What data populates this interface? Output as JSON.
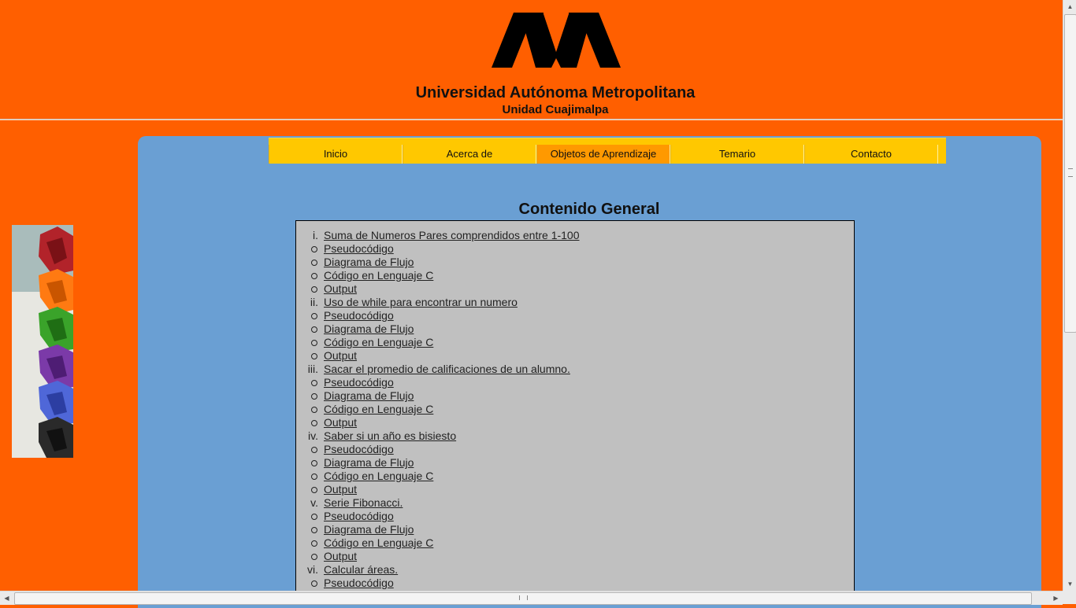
{
  "header": {
    "university": "Universidad Autónoma Metropolitana",
    "campus": "Unidad Cuajimalpa"
  },
  "nav": [
    {
      "label": "Inicio",
      "active": false
    },
    {
      "label": "Acerca de",
      "active": false
    },
    {
      "label": "Objetos de Aprendizaje",
      "active": true
    },
    {
      "label": "Temario",
      "active": false
    },
    {
      "label": "Contacto",
      "active": false
    }
  ],
  "main": {
    "title": "Contenido General",
    "topics": [
      {
        "marker": "i.",
        "title": "Suma de Numeros Pares comprendidos entre 1-100",
        "subs": [
          "Pseudocódigo",
          "Diagrama de Flujo",
          "Código en Lenguaje C",
          "Output"
        ]
      },
      {
        "marker": "ii.",
        "title": "Uso de while para encontrar un numero",
        "subs": [
          "Pseudocódigo",
          "Diagrama de Flujo",
          "Código en Lenguaje C",
          "Output"
        ]
      },
      {
        "marker": "iii.",
        "title": "Sacar el promedio de calificaciones de un alumno.",
        "subs": [
          "Pseudocódigo",
          "Diagrama de Flujo",
          "Código en Lenguaje C",
          "Output"
        ]
      },
      {
        "marker": "iv.",
        "title": "Saber si un año es bisiesto",
        "subs": [
          "Pseudocódigo",
          "Diagrama de Flujo",
          "Código en Lenguaje C",
          "Output"
        ]
      },
      {
        "marker": "v.",
        "title": "Serie Fibonacci.",
        "subs": [
          "Pseudocódigo",
          "Diagrama de Flujo",
          "Código en Lenguaje C",
          "Output"
        ]
      },
      {
        "marker": "vi.",
        "title": "Calcular áreas.",
        "subs": [
          "Pseudocódigo"
        ]
      }
    ]
  },
  "colors": {
    "page_bg": "#ff5f00",
    "panel_bg": "#6a9fd3",
    "nav_bg": "#ffc800",
    "nav_active": "#ff9900",
    "content_bg": "#c0c0c0"
  }
}
